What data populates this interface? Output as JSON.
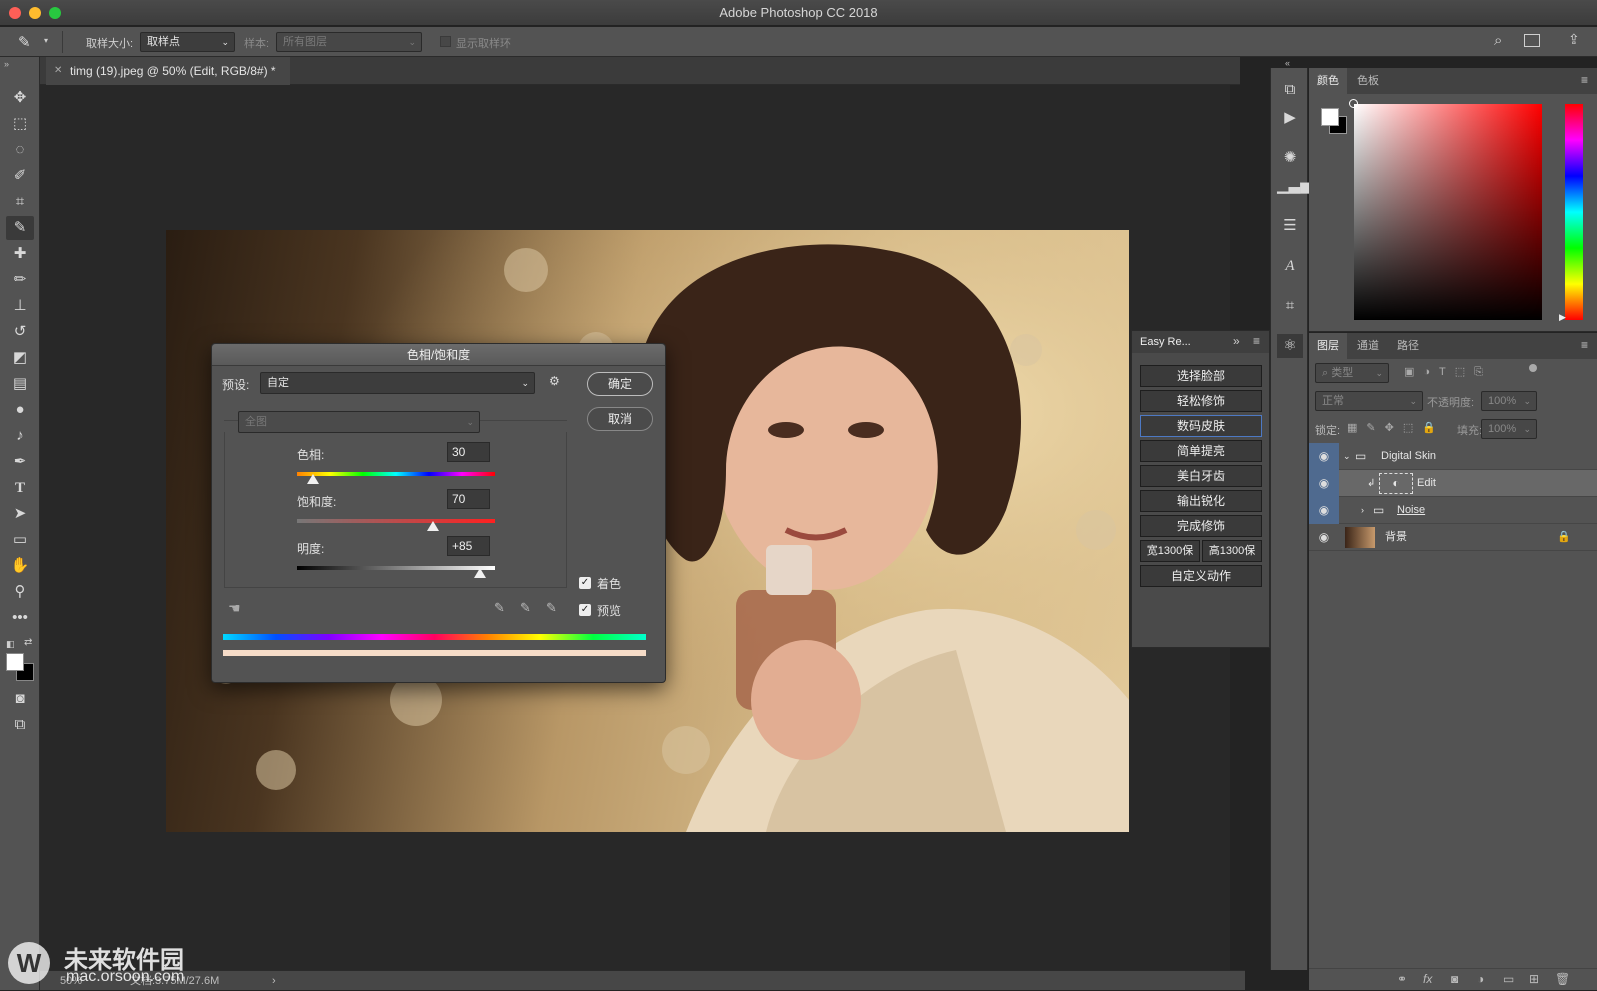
{
  "app": {
    "window_title": "Adobe Photoshop CC 2018"
  },
  "options_bar": {
    "sample_size_label": "取样大小:",
    "sample_size_value": "取样点",
    "sample_label": "样本:",
    "sample_value": "所有图层",
    "show_ring_label": "显示取样环"
  },
  "document": {
    "tab_title": "timg (19).jpeg @ 50% (Edit, RGB/8#) *",
    "zoom": "50%",
    "doc_size": "文档:3.75M/27.6M"
  },
  "hue_sat_dialog": {
    "title": "色相/饱和度",
    "preset_label": "预设:",
    "preset_value": "自定",
    "ok_label": "确定",
    "cancel_label": "取消",
    "channel_value": "全图",
    "hue_label": "色相:",
    "hue_value": "30",
    "saturation_label": "饱和度:",
    "saturation_value": "70",
    "lightness_label": "明度:",
    "lightness_value": "+85",
    "colorize_label": "着色",
    "colorize_checked": true,
    "preview_label": "预览",
    "preview_checked": true,
    "hue_slider_fraction": 0.083,
    "saturation_slider_fraction": 0.685,
    "lightness_slider_fraction": 0.925
  },
  "easy_retouch": {
    "title": "Easy Re...",
    "buttons": [
      "选择脸部",
      "轻松修饰",
      "数码皮肤",
      "简单提亮",
      "美白牙齿",
      "输出锐化",
      "完成修饰"
    ],
    "width_button": "宽1300保",
    "height_button": "高1300保",
    "custom_button": "自定义动作"
  },
  "color_panel": {
    "tabs": [
      "颜色",
      "色板"
    ],
    "foreground": "#ffffff",
    "background": "#000000"
  },
  "layers_panel": {
    "tabs": [
      "图层",
      "通道",
      "路径"
    ],
    "filter_placeholder": "类型",
    "blend_mode": "正常",
    "opacity_label": "不透明度:",
    "opacity_value": "100%",
    "lock_label": "锁定:",
    "fill_label": "填充:",
    "fill_value": "100%",
    "layers": [
      {
        "name": "Digital Skin",
        "type": "group"
      },
      {
        "name": "Edit",
        "type": "adjustment"
      },
      {
        "name": "Noise",
        "type": "group"
      },
      {
        "name": "背景",
        "type": "image"
      }
    ]
  },
  "watermark": {
    "brand": "未来软件园",
    "url": "mac.orsoon.com"
  }
}
